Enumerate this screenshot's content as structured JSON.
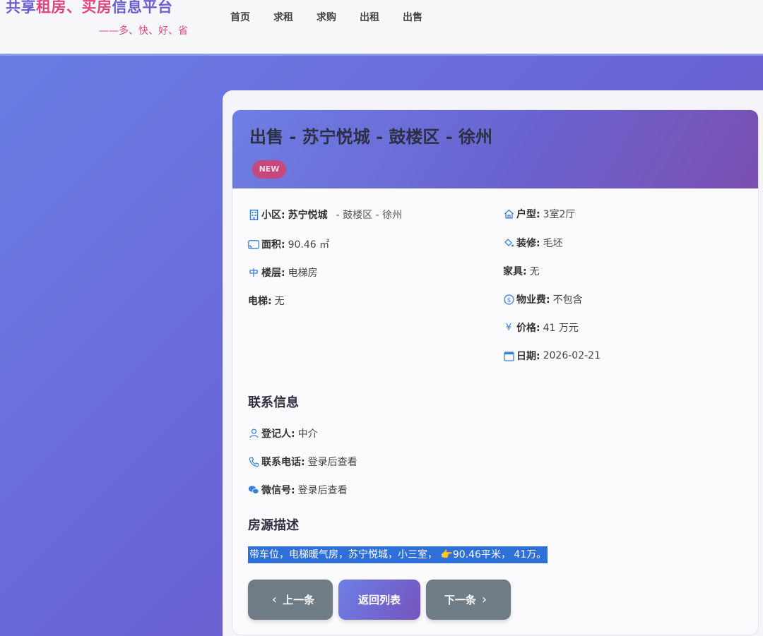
{
  "header": {
    "logo": {
      "part1": "共享",
      "part2": "租房、买房",
      "part3": "信息平台",
      "slogan": "——多、快、好、省"
    },
    "nav": [
      "首页",
      "求租",
      "求购",
      "出租",
      "出售"
    ]
  },
  "listing": {
    "title": "出售 - 苏宁悦城 - 鼓楼区 - 徐州",
    "badge": "NEW",
    "fields_left": [
      {
        "icon": "building-icon",
        "label": "小区:",
        "value": "苏宁悦城",
        "extra": "- 鼓楼区 - 徐州"
      },
      {
        "icon": "area-icon",
        "label": "面积:",
        "value": "90.46 ㎡"
      },
      {
        "icon": "floor-icon",
        "label": "楼层:",
        "value": "电梯房"
      },
      {
        "icon": "",
        "label": "电梯:",
        "value": "无"
      }
    ],
    "fields_right": [
      {
        "icon": "house-icon",
        "label": "户型:",
        "value": "3室2厅"
      },
      {
        "icon": "paint-icon",
        "label": "装修:",
        "value": "毛坯"
      },
      {
        "icon": "",
        "label": "家具:",
        "value": "无"
      },
      {
        "icon": "coin-icon",
        "label": "物业费:",
        "value": "不包含"
      },
      {
        "icon": "yen-icon",
        "label": "价格:",
        "value": "41 万元"
      },
      {
        "icon": "calendar-icon",
        "label": "日期:",
        "value": "2026-02-21"
      }
    ]
  },
  "contact": {
    "title": "联系信息",
    "fields": [
      {
        "icon": "person-icon",
        "label": "登记人:",
        "value": "中介"
      },
      {
        "icon": "phone-icon",
        "label": "联系电话:",
        "value": "登录后查看"
      },
      {
        "icon": "wechat-icon",
        "label": "微信号:",
        "value": "登录后查看"
      }
    ]
  },
  "description": {
    "title": "房源描述",
    "text": "带车位，电梯暖气房，苏宁悦城，小三室， 👉90.46平米， 41万。"
  },
  "buttons": {
    "prev": "上一条",
    "back": "返回列表",
    "next": "下一条"
  },
  "colors": {
    "accent": "#6a63d6",
    "brand_pink": "#e0457d",
    "icon_blue": "#3b7fd8"
  }
}
